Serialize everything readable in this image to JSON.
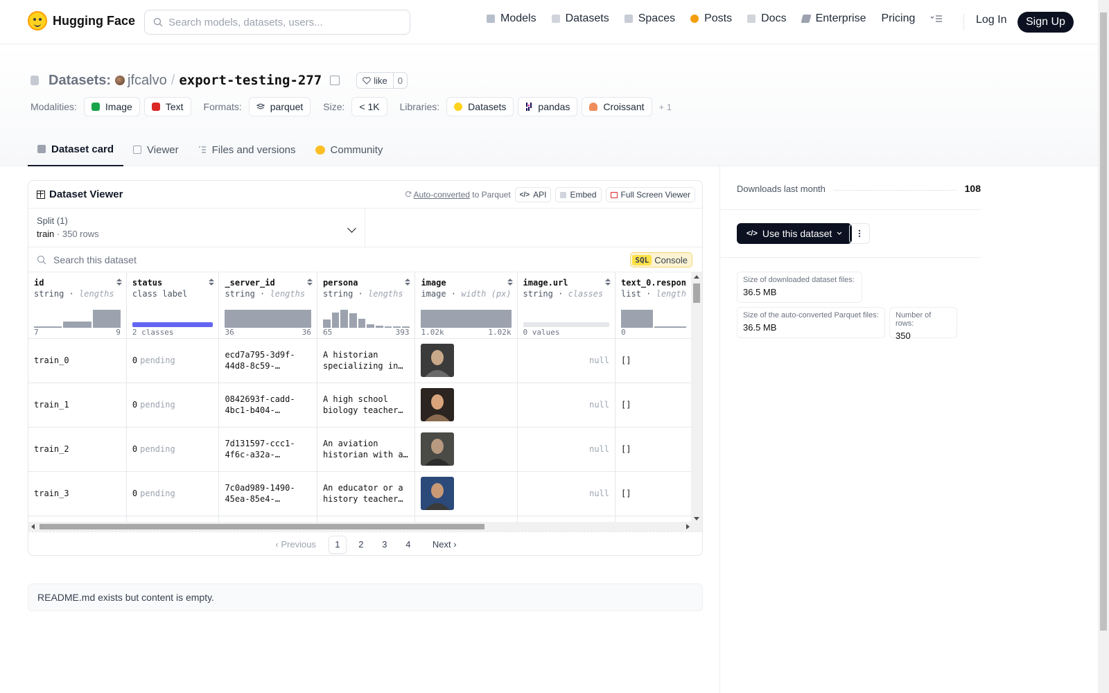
{
  "nav": {
    "brand": "Hugging Face",
    "search_placeholder": "Search models, datasets, users...",
    "links": [
      "Models",
      "Datasets",
      "Spaces",
      "Posts",
      "Docs",
      "Enterprise",
      "Pricing"
    ],
    "login": "Log In",
    "signup": "Sign Up"
  },
  "header": {
    "section": "Datasets:",
    "owner": "jfcalvo",
    "slash": "/",
    "repo": "export-testing-277",
    "like_label": "like",
    "like_count": "0",
    "modalities_label": "Modalities:",
    "modalities": [
      "Image",
      "Text"
    ],
    "formats_label": "Formats:",
    "formats": [
      "parquet"
    ],
    "size_label": "Size:",
    "size": "< 1K",
    "libraries_label": "Libraries:",
    "libraries": [
      "Datasets",
      "pandas",
      "Croissant"
    ],
    "libraries_more": "+ 1"
  },
  "tabs": [
    "Dataset card",
    "Viewer",
    "Files and versions",
    "Community"
  ],
  "viewer": {
    "title": "Dataset Viewer",
    "auto_converted": "Auto-converted",
    "to_parquet": "to Parquet",
    "api": "API",
    "embed": "Embed",
    "fullscreen": "Full Screen Viewer",
    "split_label": "Split (1)",
    "split_name": "train",
    "split_rows": "350 rows",
    "search_placeholder": "Search this dataset",
    "sql_tag": "SQL",
    "sql_label": "Console",
    "columns": [
      {
        "name": "id",
        "type": "string",
        "detail": "lengths",
        "min": "7",
        "max": "9"
      },
      {
        "name": "status",
        "type": "class label",
        "detail": "",
        "min": "2 classes",
        "max": ""
      },
      {
        "name": "_server_id",
        "type": "string",
        "detail": "lengths",
        "min": "36",
        "max": "36"
      },
      {
        "name": "persona",
        "type": "string",
        "detail": "lengths",
        "min": "65",
        "max": "393"
      },
      {
        "name": "image",
        "type": "image",
        "detail": "width (px)",
        "min": "1.02k",
        "max": "1.02k"
      },
      {
        "name": "image.url",
        "type": "string",
        "detail": "classes",
        "min": "0 values",
        "max": ""
      },
      {
        "name": "text_0.respon",
        "type": "list",
        "detail": "length",
        "min": "0",
        "max": ""
      }
    ],
    "histograms": {
      "id": [
        0.05,
        0.35,
        1.0
      ],
      "server_id": [
        1.0
      ],
      "persona": [
        0.45,
        0.85,
        1.0,
        0.8,
        0.5,
        0.2,
        0.12,
        0.05,
        0.03,
        0.03
      ],
      "image": [
        1.0
      ],
      "text0": [
        1.0,
        0.05
      ]
    },
    "rows": [
      {
        "id": "train_0",
        "status": "0",
        "status_label": "pending",
        "server_id": "ecd7a795-3d9f-44d8-8c59-…",
        "persona": "A historian specializing in…",
        "image_url": "null",
        "text0": "[]",
        "thumb": [
          "#3b3b3b",
          "#c9a98a",
          "#6b6b6b"
        ]
      },
      {
        "id": "train_1",
        "status": "0",
        "status_label": "pending",
        "server_id": "0842693f-cadd-4bc1-b404-…",
        "persona": "A high school biology teacher…",
        "image_url": "null",
        "text0": "[]",
        "thumb": [
          "#2b2420",
          "#d9a47c",
          "#8a6b50"
        ]
      },
      {
        "id": "train_2",
        "status": "0",
        "status_label": "pending",
        "server_id": "7d131597-ccc1-4f6c-a32a-…",
        "persona": "An aviation historian with a…",
        "image_url": "null",
        "text0": "[]",
        "thumb": [
          "#4a4a46",
          "#b89a80",
          "#2d2d2d"
        ]
      },
      {
        "id": "train_3",
        "status": "0",
        "status_label": "pending",
        "server_id": "7c0ad989-1490-45ea-85e4-…",
        "persona": "An educator or a history teacher…",
        "image_url": "null",
        "text0": "[]",
        "thumb": [
          "#2b4a7a",
          "#c99875",
          "#3a3a3a"
        ]
      }
    ],
    "pager": {
      "prev": "Previous",
      "pages": [
        "1",
        "2",
        "3",
        "4"
      ],
      "next": "Next",
      "current": "1"
    }
  },
  "readme": "README.md exists but content is empty.",
  "sidebar": {
    "downloads_label": "Downloads last month",
    "downloads_value": "108",
    "use_button": "Use this dataset",
    "stats": [
      {
        "label": "Size of downloaded dataset files:",
        "value": "36.5 MB"
      },
      {
        "label": "Size of the auto-converted Parquet files:",
        "value": "36.5 MB"
      },
      {
        "label": "Number of rows:",
        "value": "350"
      }
    ]
  },
  "colors": {
    "accent_dark": "#0b1120",
    "class_bar": "#6366f1",
    "hist_bar": "#9ca3af",
    "sql_yellow": "#fde047"
  }
}
